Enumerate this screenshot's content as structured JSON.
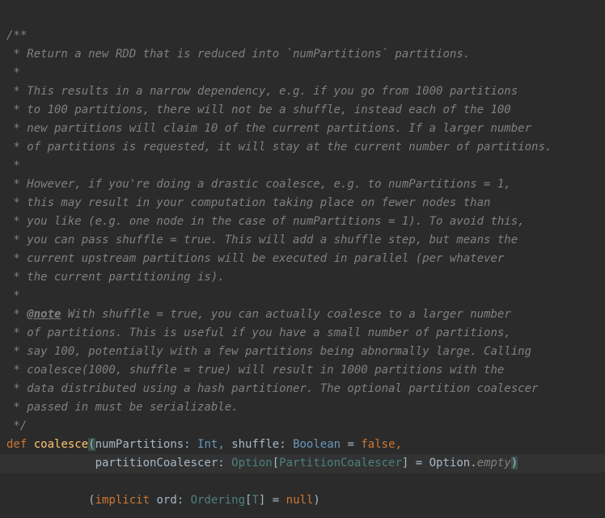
{
  "doc": {
    "l01": "/**",
    "l02": " * Return a new RDD that is reduced into `numPartitions` partitions.",
    "l03": " *",
    "l04": " * This results in a narrow dependency, e.g. if you go from 1000 partitions",
    "l05": " * to 100 partitions, there will not be a shuffle, instead each of the 100",
    "l06": " * new partitions will claim 10 of the current partitions. If a larger number",
    "l07": " * of partitions is requested, it will stay at the current number of partitions.",
    "l08": " *",
    "l09": " * However, if you're doing a drastic coalesce, e.g. to numPartitions = 1,",
    "l10": " * this may result in your computation taking place on fewer nodes than",
    "l11": " * you like (e.g. one node in the case of numPartitions = 1). To avoid this,",
    "l12": " * you can pass shuffle = true. This will add a shuffle step, but means the",
    "l13": " * current upstream partitions will be executed in parallel (per whatever",
    "l14": " * the current partitioning is).",
    "l15": " *",
    "l16p": " * ",
    "l16tag": "@note",
    "l16r": " With shuffle = true, you can actually coalesce to a larger number",
    "l17": " * of partitions. This is useful if you have a small number of partitions,",
    "l18": " * say 100, potentially with a few partitions being abnormally large. Calling",
    "l19": " * coalesce(1000, shuffle = true) will result in 1000 partitions with the",
    "l20": " * data distributed using a hash partitioner. The optional partition coalescer",
    "l21": " * passed in must be serializable.",
    "l22": " */"
  },
  "sig": {
    "def_kw": "def",
    "fn": "coalesce",
    "lparen": "(",
    "p1_name": "numPartitions: ",
    "p1_type": "Int,",
    "p2_pre": " shuffle: ",
    "p2_type": "Boolean",
    "eq": " = ",
    "false_kw": "false,",
    "line2_indent": "             ",
    "p3_name": "partitionCoalescer: ",
    "option1": "Option",
    "lbracket1": "[",
    "pc_type": "PartitionCoalescer",
    "rbracket1": "]",
    "eq2": " = ",
    "option2": "Option.",
    "empty": "empty",
    "rparen": ")",
    "line3_indent": "            ",
    "lparen2": "(",
    "implicit_kw": "implicit",
    "ord": " ord: ",
    "ordering": "Ordering",
    "lbracket2": "[",
    "tparam": "T",
    "rbracket2": "]",
    "eq3": " = ",
    "null_kw": "null",
    "rparen2": ")"
  }
}
